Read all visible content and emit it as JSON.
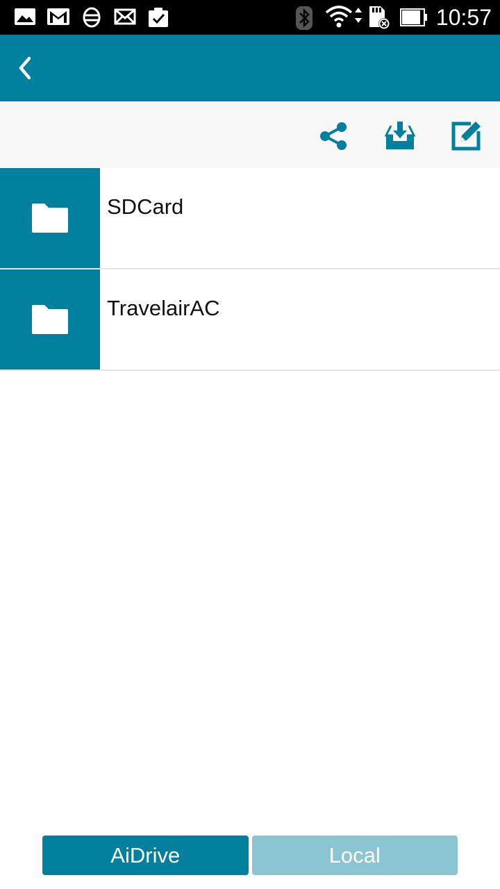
{
  "theme": {
    "primary": "#00809D",
    "primary_light": "#8CC5D2",
    "toolbar_bg": "#F8F8F8"
  },
  "status_bar": {
    "time": "10:57",
    "left_icons": [
      "gallery-icon",
      "gmail-icon",
      "sync-icon",
      "mail-icon",
      "clipboard-check-icon"
    ],
    "right_icons": [
      "bluetooth-icon",
      "wifi-icon",
      "sd-card-error-icon",
      "battery-icon"
    ]
  },
  "app_bar": {
    "back_icon": "chevron-left-icon"
  },
  "toolbar": {
    "actions": [
      "share-icon",
      "download-icon",
      "edit-icon"
    ]
  },
  "files": [
    {
      "name": "SDCard",
      "icon": "folder-icon"
    },
    {
      "name": "TravelairAC",
      "icon": "folder-icon"
    }
  ],
  "bottom_tabs": {
    "aidrive": "AiDrive",
    "local": "Local",
    "selected": "AiDrive"
  }
}
